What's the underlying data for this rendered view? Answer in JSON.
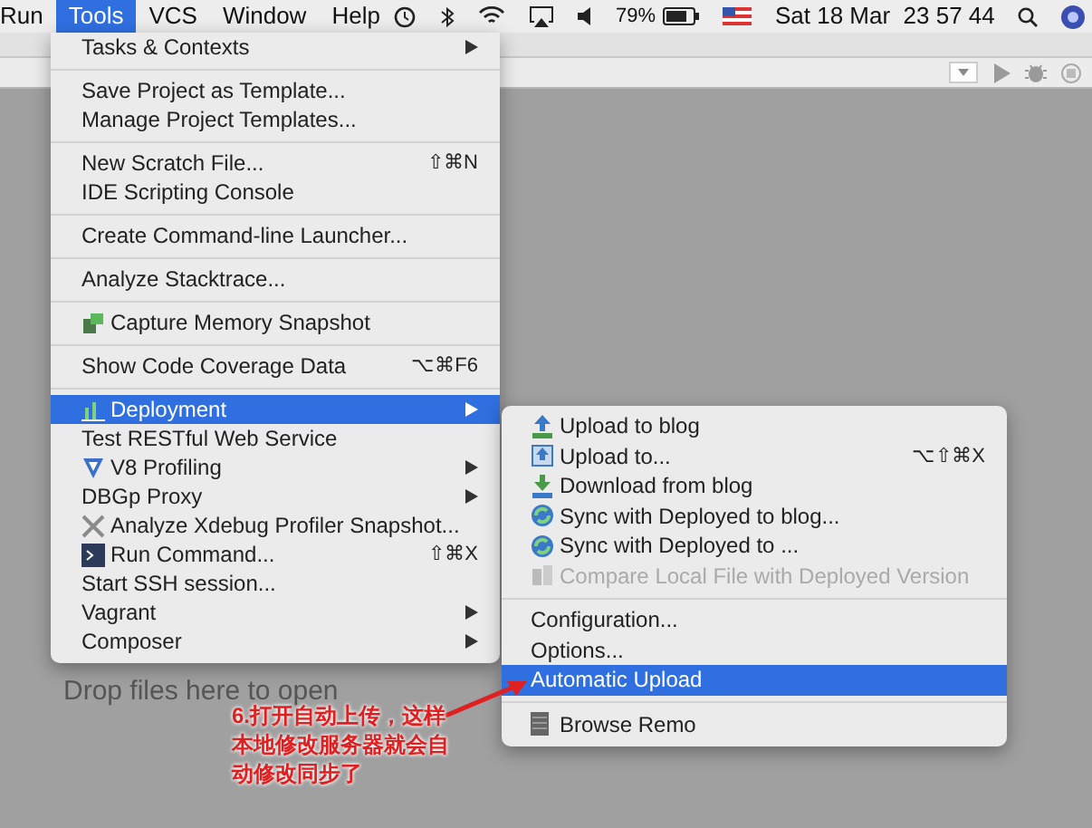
{
  "menubar": {
    "items": [
      {
        "label": "Run",
        "selected": false
      },
      {
        "label": "Tools",
        "selected": true
      },
      {
        "label": "VCS",
        "selected": false
      },
      {
        "label": "Window",
        "selected": false
      },
      {
        "label": "Help",
        "selected": false
      }
    ],
    "battery_percent": "79%",
    "clock": "Sat 18 Mar  23 57 44"
  },
  "background_hint": "Drop files here to open",
  "tools_menu": {
    "groups": [
      [
        {
          "label": "Tasks & Contexts",
          "submenu": true,
          "selected": false
        }
      ],
      [
        {
          "label": "Save Project as Template...",
          "submenu": false,
          "selected": false
        },
        {
          "label": "Manage Project Templates...",
          "submenu": false,
          "selected": false
        }
      ],
      [
        {
          "label": "New Scratch File...",
          "shortcut": "⇧⌘N",
          "submenu": false,
          "selected": false
        },
        {
          "label": "IDE Scripting Console",
          "submenu": false,
          "selected": false
        }
      ],
      [
        {
          "label": "Create Command-line Launcher...",
          "submenu": false,
          "selected": false
        }
      ],
      [
        {
          "label": "Analyze Stacktrace...",
          "submenu": false,
          "selected": false
        }
      ],
      [
        {
          "label": "Capture Memory Snapshot",
          "submenu": false,
          "selected": false
        }
      ],
      [
        {
          "label": "Show Code Coverage Data",
          "shortcut": "⌥⌘F6",
          "submenu": false,
          "selected": false
        }
      ],
      [
        {
          "label": "Deployment",
          "submenu": true,
          "selected": true
        },
        {
          "label": "Test RESTful Web Service",
          "submenu": false,
          "selected": false
        },
        {
          "label": "V8 Profiling",
          "submenu": true,
          "selected": false
        },
        {
          "label": "DBGp Proxy",
          "submenu": true,
          "selected": false
        },
        {
          "label": "Analyze Xdebug Profiler Snapshot...",
          "submenu": false,
          "selected": false
        },
        {
          "label": "Run Command...",
          "shortcut": "⇧⌘X",
          "submenu": false,
          "selected": false
        },
        {
          "label": "Start SSH session...",
          "submenu": false,
          "selected": false
        },
        {
          "label": "Vagrant",
          "submenu": true,
          "selected": false
        },
        {
          "label": "Composer",
          "submenu": true,
          "selected": false
        }
      ]
    ]
  },
  "deployment_menu": {
    "groups": [
      [
        {
          "label": "Upload to blog",
          "selected": false,
          "disabled": false
        },
        {
          "label": "Upload to...",
          "shortcut": "⌥⇧⌘X",
          "selected": false,
          "disabled": false
        },
        {
          "label": "Download from blog",
          "selected": false,
          "disabled": false
        },
        {
          "label": "Sync with Deployed to blog...",
          "selected": false,
          "disabled": false
        },
        {
          "label": "Sync with Deployed to ...",
          "selected": false,
          "disabled": false
        },
        {
          "label": "Compare Local File with Deployed Version",
          "selected": false,
          "disabled": true
        }
      ],
      [
        {
          "label": "Configuration...",
          "selected": false,
          "disabled": false
        },
        {
          "label": "Options...",
          "selected": false,
          "disabled": false
        },
        {
          "label": "Automatic Upload",
          "selected": true,
          "disabled": false
        }
      ],
      [
        {
          "label": "Browse Remo",
          "selected": false,
          "disabled": false
        }
      ]
    ]
  },
  "annotation": {
    "text": "6.打开自动上传，这样本地修改服务器就会自动修改同步了"
  }
}
